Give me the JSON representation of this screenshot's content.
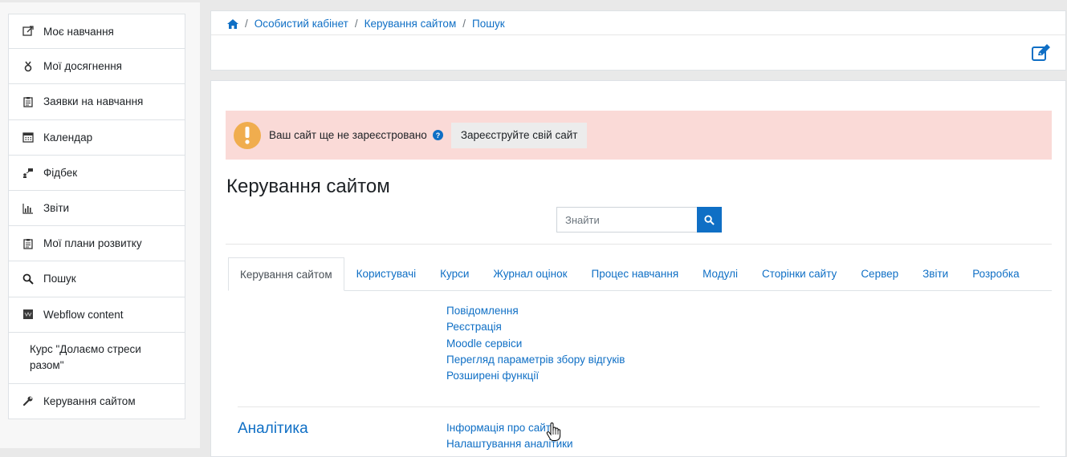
{
  "sidebar": {
    "items": [
      {
        "label": "Моє навчання",
        "icon": "book-icon"
      },
      {
        "label": "Мої досягнення",
        "icon": "medal-icon"
      },
      {
        "label": "Заявки на навчання",
        "icon": "clipboard-icon"
      },
      {
        "label": "Календар",
        "icon": "calendar-icon"
      },
      {
        "label": "Фідбек",
        "icon": "feedback-icon"
      },
      {
        "label": "Звіти",
        "icon": "chart-icon"
      },
      {
        "label": "Мої плани розвитку",
        "icon": "clipboard-icon"
      },
      {
        "label": "Пошук",
        "icon": "search-icon"
      },
      {
        "label": "Webflow content",
        "icon": "webflow-icon"
      },
      {
        "label": "Курс \"Долаємо стреси разом\""
      },
      {
        "label": "Керування сайтом",
        "icon": "wrench-icon"
      }
    ]
  },
  "breadcrumb": {
    "items": [
      "Особистий кабінет",
      "Керування сайтом",
      "Пошук"
    ]
  },
  "alert": {
    "text": "Ваш сайт ще не зареєстровано",
    "button": "Зареєструйте свій сайт"
  },
  "page": {
    "title": "Керування сайтом"
  },
  "search": {
    "placeholder": "Знайти"
  },
  "tabs": [
    "Керування сайтом",
    "Користувачі",
    "Курси",
    "Журнал оцінок",
    "Процес навчання",
    "Модулі",
    "Сторінки сайту",
    "Сервер",
    "Звіти",
    "Розробка"
  ],
  "general_links": [
    "Повідомлення",
    "Реєстрація",
    "Moodle сервіси",
    "Перегляд параметрів збору відгуків",
    "Розширені функції"
  ],
  "analytics": {
    "title": "Аналітика",
    "links": [
      "Інформація про сайт",
      "Налаштування аналітики"
    ]
  },
  "colors": {
    "link": "#0f6fc5",
    "alert_bg": "#fadad7",
    "warning": "#f0ad4e"
  }
}
